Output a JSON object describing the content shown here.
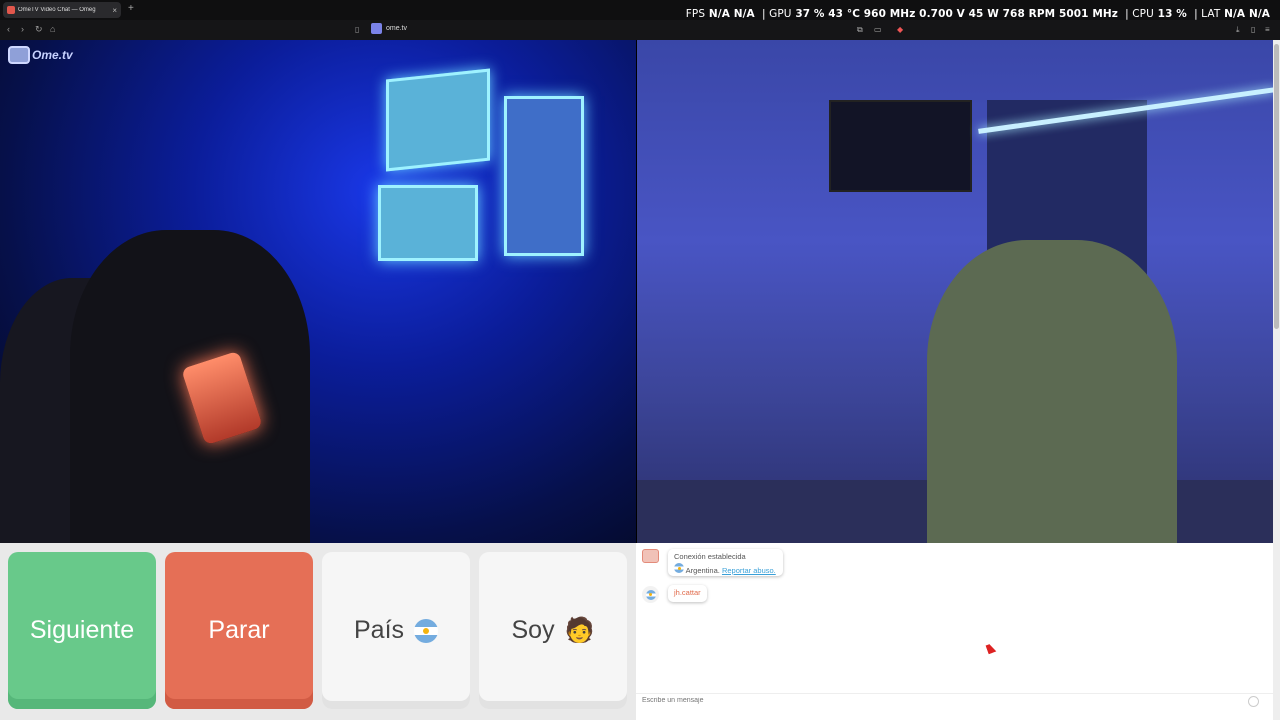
{
  "browser": {
    "tab_title": "OmeTV Video Chat — Omeg",
    "url": "ome.tv"
  },
  "hud": {
    "fps_label": "FPS",
    "fps_value": "N/A",
    "fps_value2": "N/A",
    "gpu_label": "GPU",
    "gpu_util": "37 %",
    "gpu_temp": "43 °C",
    "gpu_clock": "960 MHz",
    "gpu_voltage": "0.700 V",
    "gpu_power": "45 W",
    "gpu_fan": "768 RPM",
    "gpu_mem": "5001 MHz",
    "cpu_label": "CPU",
    "cpu_util": "13 %",
    "lat_label": "LAT",
    "lat_value": "N/A",
    "lat_value2": "N/A"
  },
  "logo": {
    "text": "Ome.tv"
  },
  "controls": {
    "next_label": "Siguiente",
    "stop_label": "Parar",
    "country_label": "País",
    "gender_label": "Soy",
    "gender_icon": "🧑"
  },
  "chat": {
    "system_title": "Conexión establecida",
    "country": "Argentina.",
    "report_link": "Reportar abuso.",
    "username": "jh.cattar",
    "input_placeholder": "Escribe un mensaje"
  },
  "colors": {
    "next": "#68c98a",
    "stop": "#e56f56",
    "accent_link": "#3aa0d8"
  }
}
